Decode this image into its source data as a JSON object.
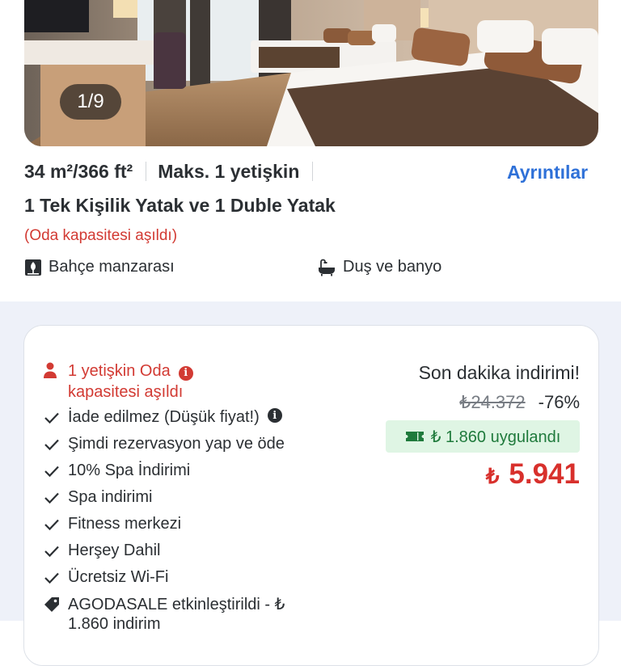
{
  "gallery": {
    "counter": "1/9"
  },
  "room": {
    "size": "34 m²/366 ft²",
    "max_guests": "Maks. 1 yetişkin",
    "details_link": "Ayrıntılar",
    "beds": "1 Tek Kişilik Yatak ve 1 Duble Yatak",
    "capacity_warning": "(Oda kapasitesi aşıldı)",
    "amenities": [
      {
        "icon": "garden-view-icon",
        "label": "Bahçe manzarası"
      },
      {
        "icon": "shower-bath-icon",
        "label": "Duş ve banyo"
      }
    ]
  },
  "offer": {
    "capacity_alert_line1": "1 yetişkin Oda",
    "capacity_alert_line2": "kapasitesi aşıldı",
    "features": [
      "İade edilmez (Düşük fiyat!)",
      "Şimdi rezervasyon yap ve öde",
      "10% Spa İndirimi",
      "Spa indirimi",
      "Fitness merkezi",
      "Herşey Dahil",
      "Ücretsiz Wi-Fi"
    ],
    "coupon_line1": "AGODASALE etkinleştirildi - ₺",
    "coupon_line2": "1.860 indirim",
    "deal_label": "Son dakika indirimi!",
    "old_price": "₺24.372",
    "discount": "-76%",
    "coupon_applied": "₺ 1.860 uygulandı",
    "currency": "₺",
    "final_price": "5.941"
  },
  "colors": {
    "accent_blue": "#2f71d8",
    "alert_red": "#d23a33",
    "price_red": "#d8302c",
    "coupon_green_bg": "#dff5e4",
    "coupon_green_text": "#1f7a3c",
    "section_bg": "#eef1f9"
  }
}
